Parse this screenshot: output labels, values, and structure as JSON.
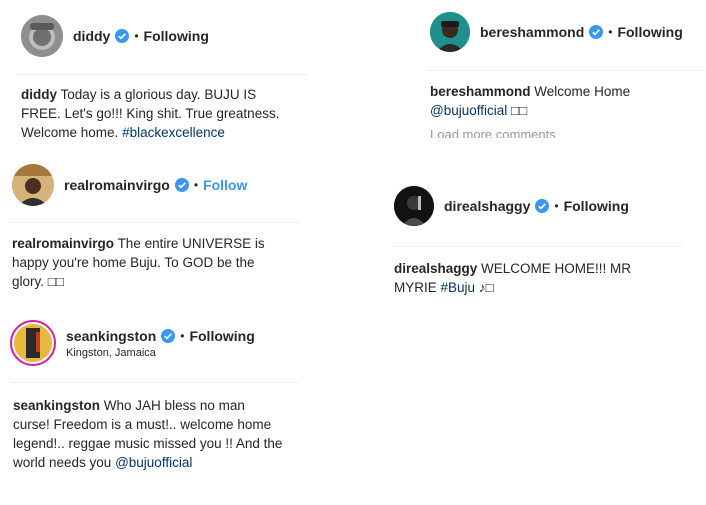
{
  "posts": [
    {
      "username": "diddy",
      "follow_label": "Following",
      "dot": "•",
      "comment_user": "diddy",
      "comment_text": "Today is a glorious day. BUJU IS FREE. Let's go!!! King shit. True greatness. Welcome home.",
      "hashtag": "#blackexcellence"
    },
    {
      "username": "bereshammond",
      "follow_label": "Following",
      "dot": "•",
      "comment_user": "bereshammond",
      "comment_text": "Welcome Home",
      "mention": "@bujuofficial",
      "emoji": "□□",
      "load_more": "Load more comments"
    },
    {
      "username": "realromainvirgo",
      "follow_label": "Follow",
      "dot": "•",
      "comment_user": "realromainvirgo",
      "comment_text": "The entire UNIVERSE is happy you're home Buju. To GOD be the glory.",
      "emoji": "□□"
    },
    {
      "username": "direalshaggy",
      "follow_label": "Following",
      "dot": "•",
      "comment_user": "direalshaggy",
      "comment_text": "WELCOME HOME!!! MR MYRIE",
      "hashtag": "#Buju",
      "emoji": "♪□"
    },
    {
      "username": "seankingston",
      "follow_label": "Following",
      "dot": "•",
      "location": "Kingston, Jamaica",
      "comment_user": "seankingston",
      "comment_text": "Who JAH bless no man curse! Freedom is a must!.. welcome home legend!.. reggae music missed you !! And the world needs you",
      "mention": "@bujuofficial"
    }
  ],
  "colors": {
    "follow_blue": "#3897f0",
    "verified_blue": "#3897f0",
    "hashtag_blue": "#003569",
    "divider": "#efefef"
  }
}
